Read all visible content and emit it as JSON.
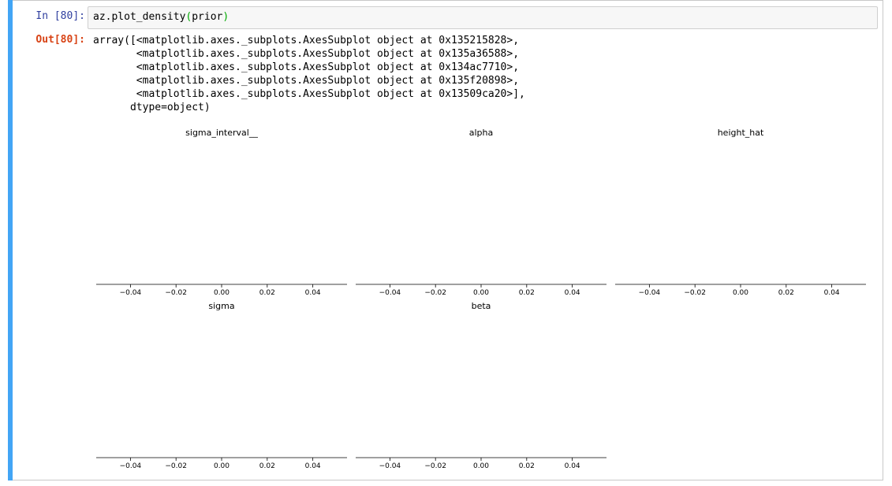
{
  "cell": {
    "in_prompt": "In [80]:",
    "out_prompt": "Out[80]:",
    "code": {
      "func": "az.plot_density",
      "open_paren": "(",
      "arg": "prior",
      "close_paren": ")"
    },
    "output_lines": [
      "array([<matplotlib.axes._subplots.AxesSubplot object at 0x135215828>,",
      "       <matplotlib.axes._subplots.AxesSubplot object at 0x135a36588>,",
      "       <matplotlib.axes._subplots.AxesSubplot object at 0x134ac7710>,",
      "       <matplotlib.axes._subplots.AxesSubplot object at 0x135f20898>,",
      "       <matplotlib.axes._subplots.AxesSubplot object at 0x13509ca20>],",
      "      dtype=object)"
    ]
  },
  "chart_data": [
    {
      "type": "line",
      "title": "sigma_interval__",
      "xlim": [
        -0.055,
        0.055
      ],
      "xticks": [
        -0.04,
        -0.02,
        0.0,
        0.02,
        0.04
      ],
      "xtick_labels": [
        "−0.04",
        "−0.02",
        "0.00",
        "0.02",
        "0.04"
      ],
      "series": []
    },
    {
      "type": "line",
      "title": "alpha",
      "xlim": [
        -0.055,
        0.055
      ],
      "xticks": [
        -0.04,
        -0.02,
        0.0,
        0.02,
        0.04
      ],
      "xtick_labels": [
        "−0.04",
        "−0.02",
        "0.00",
        "0.02",
        "0.04"
      ],
      "series": []
    },
    {
      "type": "line",
      "title": "height_hat",
      "xlim": [
        -0.055,
        0.055
      ],
      "xticks": [
        -0.04,
        -0.02,
        0.0,
        0.02,
        0.04
      ],
      "xtick_labels": [
        "−0.04",
        "−0.02",
        "0.00",
        "0.02",
        "0.04"
      ],
      "series": []
    },
    {
      "type": "line",
      "title": "sigma",
      "xlim": [
        -0.055,
        0.055
      ],
      "xticks": [
        -0.04,
        -0.02,
        0.0,
        0.02,
        0.04
      ],
      "xtick_labels": [
        "−0.04",
        "−0.02",
        "0.00",
        "0.02",
        "0.04"
      ],
      "series": []
    },
    {
      "type": "line",
      "title": "beta",
      "xlim": [
        -0.055,
        0.055
      ],
      "xticks": [
        -0.04,
        -0.02,
        0.0,
        0.02,
        0.04
      ],
      "xtick_labels": [
        "−0.04",
        "−0.02",
        "0.00",
        "0.02",
        "0.04"
      ],
      "series": []
    }
  ]
}
